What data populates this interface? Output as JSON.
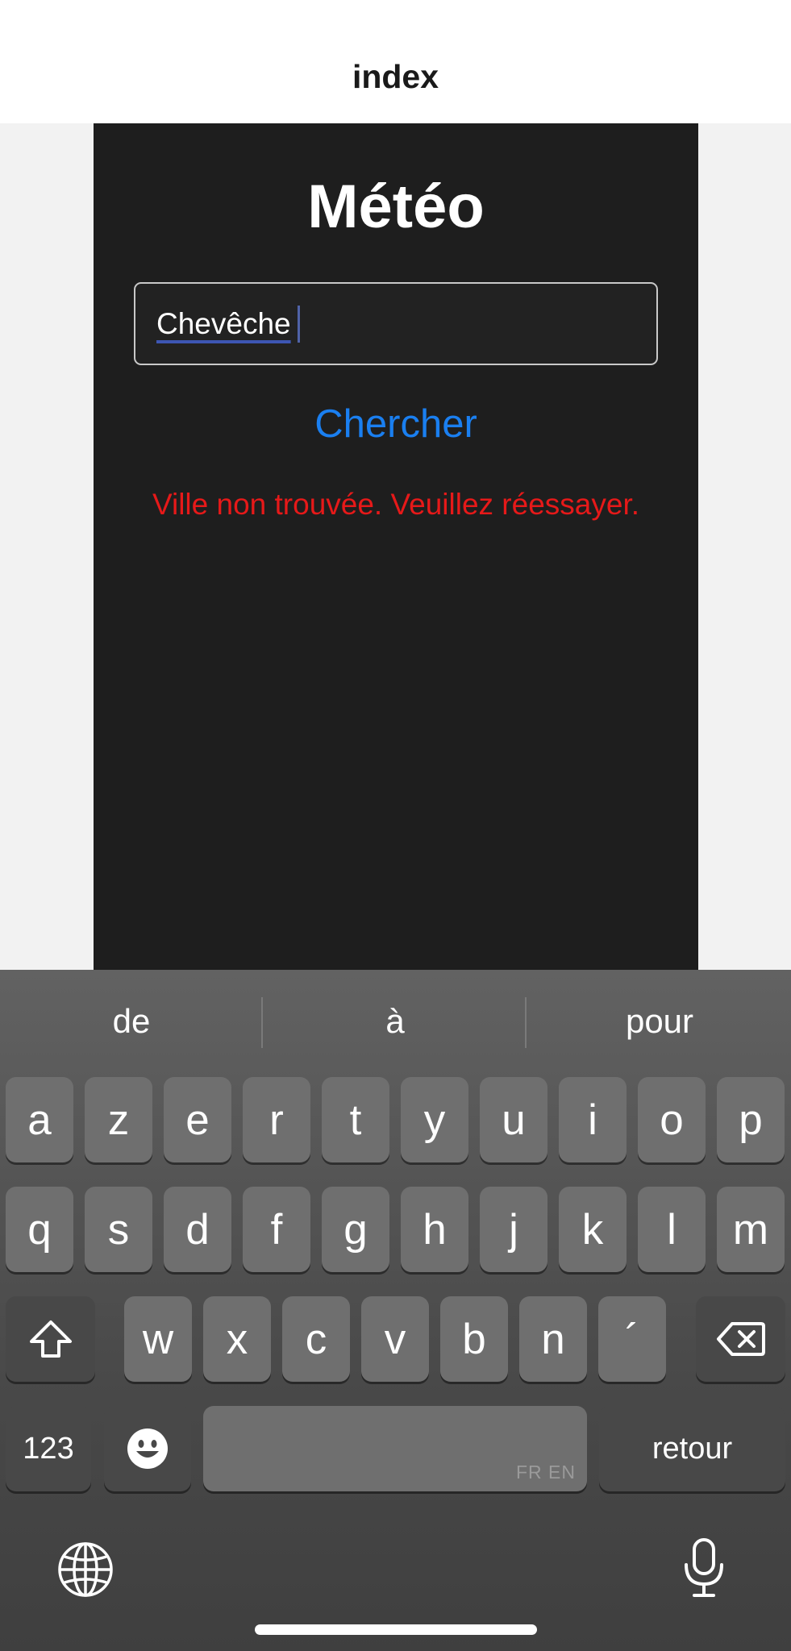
{
  "colors": {
    "panel_bg": "#1e1e1e",
    "accent_blue": "#1a7ff0",
    "error_red": "#e61919",
    "key_bg": "#6f6f6f",
    "key_dark_bg": "#484848"
  },
  "nav": {
    "title": "index"
  },
  "app": {
    "title": "Météo",
    "search_input": {
      "value": "Chevêche"
    },
    "search_button": "Chercher",
    "error_message": "Ville non trouvée. Veuillez réessayer."
  },
  "keyboard": {
    "suggestions": [
      "de",
      "à",
      "pour"
    ],
    "row1": [
      "a",
      "z",
      "e",
      "r",
      "t",
      "y",
      "u",
      "i",
      "o",
      "p"
    ],
    "row2": [
      "q",
      "s",
      "d",
      "f",
      "g",
      "h",
      "j",
      "k",
      "l",
      "m"
    ],
    "row3": [
      "w",
      "x",
      "c",
      "v",
      "b",
      "n",
      "´"
    ],
    "numbers_key": "123",
    "space_lang": "FR EN",
    "return_key": "retour",
    "icons": {
      "shift": "shift-arrow-icon",
      "delete": "backspace-icon",
      "emoji": "emoji-icon",
      "globe": "globe-icon",
      "mic": "microphone-icon"
    }
  }
}
